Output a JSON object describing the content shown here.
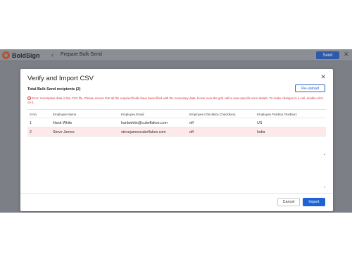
{
  "app": {
    "brand": "BoldSign",
    "page_title": "Prepare Bulk Send",
    "send_label": "Send"
  },
  "modal": {
    "title": "Verify and Import CSV",
    "recipients_label": "Total Bulk Send recipients (2)",
    "reupload_label": "Re-upload",
    "error_text": "Error: Incomplete data in the CSV file. Please ensure that all the required fields have been filled with the necessary data. Hover over the grid cell to view specific error details. To make changes in a cell, double-click on it.",
    "columns": [
      "S.No",
      "Employee.Name",
      "Employee.Email",
      "Employee.CheckBox.CheckBox1",
      "Employee.TextBox.TextBox1"
    ],
    "rows": [
      [
        "1",
        "Hank White",
        "hankwhite@cubeflakes.com",
        "off",
        "US"
      ],
      [
        "2",
        "Steve James",
        "stevejamescubeflakes.com",
        "off",
        "India"
      ]
    ],
    "cancel_label": "Cancel",
    "import_label": "Import"
  },
  "colors": {
    "brand": "#b4532f",
    "primary": "#1e63d6",
    "error": "#d93636",
    "error_row": "#fde9e9"
  },
  "icons": {
    "back": "chevron-left-icon",
    "close": "close-icon",
    "error": "error-icon"
  }
}
